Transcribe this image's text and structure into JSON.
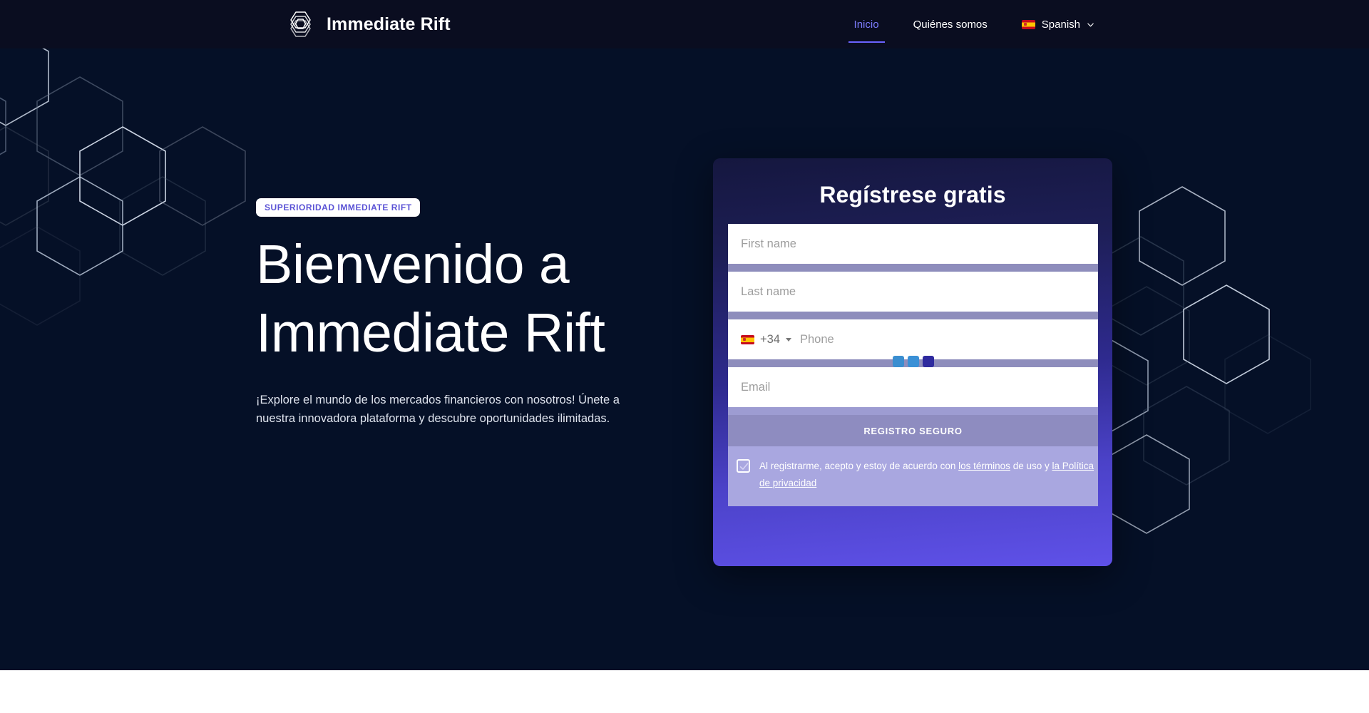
{
  "header": {
    "brand_name": "Immediate Rift",
    "logo_icon": "hexagon-layers-logo-icon",
    "nav": [
      {
        "label": "Inicio",
        "active": true
      },
      {
        "label": "Quiénes somos",
        "active": false
      }
    ],
    "language": {
      "label": "Spanish",
      "flag_icon": "spain-flag-icon",
      "chevron_icon": "chevron-down-icon"
    }
  },
  "hero": {
    "badge": "SUPERIORIDAD IMMEDIATE RIFT",
    "headline": "Bienvenido a Immediate Rift",
    "subtext": "¡Explore el mundo de los mercados financieros con nosotros! Únete a nuestra innovadora plataforma y descubre oportunidades ilimitadas."
  },
  "form": {
    "title": "Regístrese gratis",
    "fields": [
      {
        "name": "first-name",
        "placeholder": "First name",
        "value": ""
      },
      {
        "name": "last-name",
        "placeholder": "Last name",
        "value": ""
      },
      {
        "name": "phone",
        "placeholder": "Phone",
        "value": "",
        "dial_code": "+34",
        "flag_icon": "spain-flag-icon"
      },
      {
        "name": "email",
        "placeholder": "Email",
        "value": ""
      }
    ],
    "submit_label": "REGISTRO SEGURO",
    "terms": {
      "checked": true,
      "prefix": "Al registrarme, acepto y estoy de acuerdo con ",
      "link_terms": "los términos",
      "middle": " de uso y ",
      "link_privacy": "la Política de privacidad"
    },
    "dots": [
      "#3a8ed0",
      "#3a90d6",
      "#2e2a9e"
    ]
  },
  "colors": {
    "page_bg": "#ffffff",
    "hero_bg": "#051027",
    "header_bg": "#0a0d20",
    "accent_purple": "#6c63ff",
    "badge_text": "#5a52d5",
    "card_top": "#15173f",
    "card_bottom": "#5f51e8",
    "field_bg": "#ffffff",
    "gap_bar": "#8e8dbc",
    "button_bg": "#8e8cc0"
  }
}
